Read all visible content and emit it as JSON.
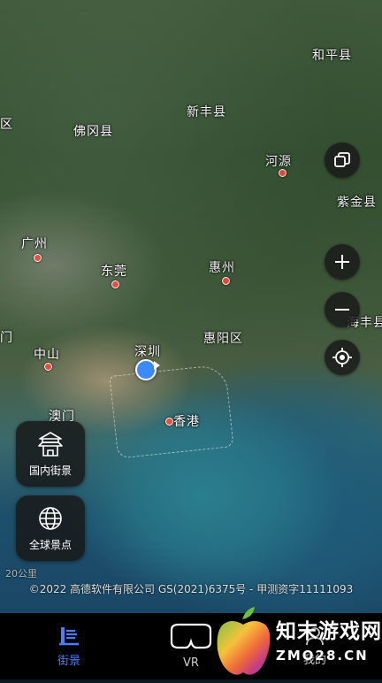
{
  "map": {
    "places": {
      "heping": "和平县",
      "xinfeng": "新丰县",
      "fogang": "佛冈县",
      "heyuan": "河源",
      "zijin": "紫金县",
      "guangzhou": "广州",
      "dongguan": "东莞",
      "huizhou": "惠州",
      "zhongshan": "中山",
      "huiyang": "惠阳区",
      "shenzhen": "深圳",
      "macau": "澳门",
      "hongkong": "香港",
      "edge_left_1": "区",
      "edge_left_2": "门",
      "edge_right": "海丰县"
    },
    "scale_text": "20公里",
    "copyright": "©2022 高德软件有限公司 GS(2021)6375号 - 甲测资字11111093"
  },
  "controls": {
    "street_view_domestic": "国内街景",
    "global_attractions": "全球景点"
  },
  "tabs": [
    {
      "label": "街景",
      "active": true
    },
    {
      "label": "VR",
      "active": false
    },
    {
      "label": "我的",
      "active": false
    }
  ],
  "watermark": {
    "brand": "知末游戏网",
    "url": "ZMO28.CN"
  },
  "colors": {
    "accent": "#4a7dff",
    "user_location": "#3d8bff",
    "city_dot": "#f24a3a",
    "tabbar": "#000000"
  }
}
